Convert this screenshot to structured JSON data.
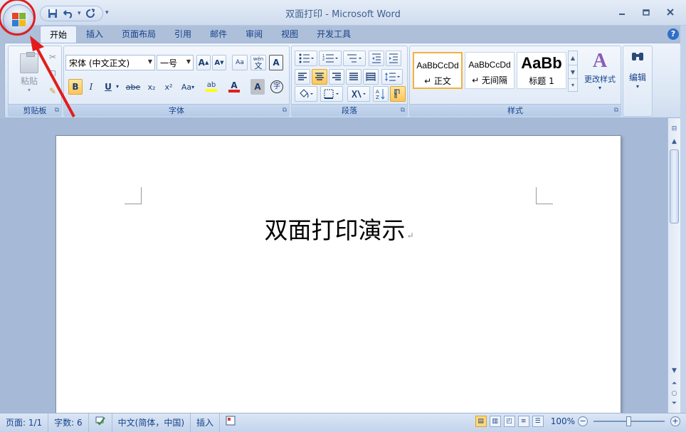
{
  "window": {
    "title": "双面打印 - Microsoft Word",
    "minimize_glyph": "▭",
    "maximize_glyph": "□",
    "close_glyph": "✕"
  },
  "qat": {
    "save_icon": "save-icon",
    "undo_icon": "undo-icon",
    "redo_icon": "redo-icon",
    "customize_glyph": "▾"
  },
  "tabs": [
    {
      "label": "开始",
      "active": true
    },
    {
      "label": "插入"
    },
    {
      "label": "页面布局"
    },
    {
      "label": "引用"
    },
    {
      "label": "邮件"
    },
    {
      "label": "审阅"
    },
    {
      "label": "视图"
    },
    {
      "label": "开发工具"
    }
  ],
  "help_glyph": "?",
  "ribbon": {
    "clipboard": {
      "label": "剪贴板",
      "paste_label": "粘贴",
      "cut_glyph": "✂",
      "format_painter_glyph": "✎"
    },
    "font": {
      "label": "字体",
      "font_name": "宋体 (中文正文)",
      "font_size": "一号",
      "grow_glyph": "A",
      "shrink_glyph": "A",
      "clear_glyph": "Aa",
      "phonetic_glyph": "wén",
      "phonetic_sub": "文",
      "border_glyph": "A",
      "bold": "B",
      "italic": "I",
      "underline": "U",
      "strike": "abe",
      "subscript": "x₂",
      "superscript": "x²",
      "change_case": "Aa",
      "highlight": "ab",
      "font_color": "A",
      "shading": "A",
      "enclose": "字"
    },
    "paragraph": {
      "label": "段落"
    },
    "styles": {
      "label": "样式",
      "cards": [
        {
          "sample": "AaBbCcDd",
          "name": "↵ 正文"
        },
        {
          "sample": "AaBbCcDd",
          "name": "↵ 无间隔"
        },
        {
          "sample": "AaBb",
          "name": "标题 1"
        }
      ],
      "change_styles": "更改样式"
    },
    "editing": {
      "label": "编辑"
    }
  },
  "document": {
    "text": "双面打印演示",
    "para_mark": "↵"
  },
  "status": {
    "page": "页面: 1/1",
    "words": "字数: 6",
    "language": "中文(简体，中国)",
    "mode": "插入",
    "zoom": "100%"
  },
  "colors": {
    "accent": "#15428b",
    "highlight_ring": "#e21c1c"
  }
}
